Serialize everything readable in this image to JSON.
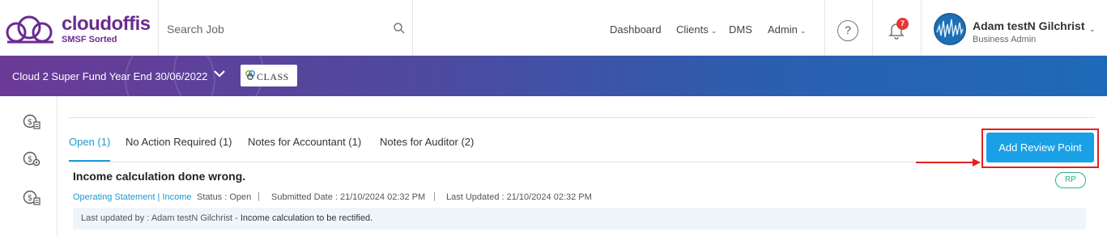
{
  "brand": {
    "name": "cloudoffis",
    "tagline": "SMSF Sorted"
  },
  "search": {
    "placeholder": "Search Job"
  },
  "nav": {
    "dashboard": "Dashboard",
    "clients": "Clients",
    "dms": "DMS",
    "admin": "Admin"
  },
  "notifications": {
    "count": "7"
  },
  "help": {
    "glyph": "?"
  },
  "user": {
    "name": "Adam testN Gilchrist",
    "role": "Business Admin"
  },
  "banner": {
    "fund": "Cloud 2 Super Fund Year End 30/06/2022",
    "software": "CLASS"
  },
  "tabs": [
    {
      "label": "Open (1)"
    },
    {
      "label": "No Action Required (1)"
    },
    {
      "label": "Notes for Accountant (1)"
    },
    {
      "label": "Notes for Auditor (2)"
    }
  ],
  "actions": {
    "add_review_point": "Add Review Point"
  },
  "review_point": {
    "title": "Income calculation done wrong.",
    "tag": "RP",
    "category": "Operating Statement | Income",
    "status": "Status : Open",
    "submitted": "Submitted Date : 21/10/2024 02:32 PM",
    "updated": "Last Updated : 21/10/2024 02:32 PM",
    "separator": "|",
    "note_prefix": "Last updated by : Adam testN Gilchrist - ",
    "note_text": "Income calculation to be rectified."
  },
  "colors": {
    "accent": "#1aa0e6",
    "brand": "#6a2c91",
    "highlight": "#e02020",
    "tag": "#2ab37a"
  }
}
